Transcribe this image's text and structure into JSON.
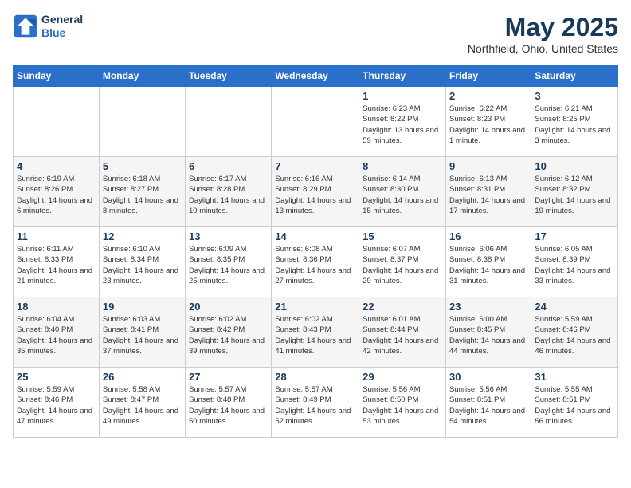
{
  "header": {
    "logo_line1": "General",
    "logo_line2": "Blue",
    "month": "May 2025",
    "location": "Northfield, Ohio, United States"
  },
  "days_of_week": [
    "Sunday",
    "Monday",
    "Tuesday",
    "Wednesday",
    "Thursday",
    "Friday",
    "Saturday"
  ],
  "weeks": [
    [
      {
        "day": "",
        "info": ""
      },
      {
        "day": "",
        "info": ""
      },
      {
        "day": "",
        "info": ""
      },
      {
        "day": "",
        "info": ""
      },
      {
        "day": "1",
        "info": "Sunrise: 6:23 AM\nSunset: 8:22 PM\nDaylight: 13 hours\nand 59 minutes."
      },
      {
        "day": "2",
        "info": "Sunrise: 6:22 AM\nSunset: 8:23 PM\nDaylight: 14 hours\nand 1 minute."
      },
      {
        "day": "3",
        "info": "Sunrise: 6:21 AM\nSunset: 8:25 PM\nDaylight: 14 hours\nand 3 minutes."
      }
    ],
    [
      {
        "day": "4",
        "info": "Sunrise: 6:19 AM\nSunset: 8:26 PM\nDaylight: 14 hours\nand 6 minutes."
      },
      {
        "day": "5",
        "info": "Sunrise: 6:18 AM\nSunset: 8:27 PM\nDaylight: 14 hours\nand 8 minutes."
      },
      {
        "day": "6",
        "info": "Sunrise: 6:17 AM\nSunset: 8:28 PM\nDaylight: 14 hours\nand 10 minutes."
      },
      {
        "day": "7",
        "info": "Sunrise: 6:16 AM\nSunset: 8:29 PM\nDaylight: 14 hours\nand 13 minutes."
      },
      {
        "day": "8",
        "info": "Sunrise: 6:14 AM\nSunset: 8:30 PM\nDaylight: 14 hours\nand 15 minutes."
      },
      {
        "day": "9",
        "info": "Sunrise: 6:13 AM\nSunset: 8:31 PM\nDaylight: 14 hours\nand 17 minutes."
      },
      {
        "day": "10",
        "info": "Sunrise: 6:12 AM\nSunset: 8:32 PM\nDaylight: 14 hours\nand 19 minutes."
      }
    ],
    [
      {
        "day": "11",
        "info": "Sunrise: 6:11 AM\nSunset: 8:33 PM\nDaylight: 14 hours\nand 21 minutes."
      },
      {
        "day": "12",
        "info": "Sunrise: 6:10 AM\nSunset: 8:34 PM\nDaylight: 14 hours\nand 23 minutes."
      },
      {
        "day": "13",
        "info": "Sunrise: 6:09 AM\nSunset: 8:35 PM\nDaylight: 14 hours\nand 25 minutes."
      },
      {
        "day": "14",
        "info": "Sunrise: 6:08 AM\nSunset: 8:36 PM\nDaylight: 14 hours\nand 27 minutes."
      },
      {
        "day": "15",
        "info": "Sunrise: 6:07 AM\nSunset: 8:37 PM\nDaylight: 14 hours\nand 29 minutes."
      },
      {
        "day": "16",
        "info": "Sunrise: 6:06 AM\nSunset: 8:38 PM\nDaylight: 14 hours\nand 31 minutes."
      },
      {
        "day": "17",
        "info": "Sunrise: 6:05 AM\nSunset: 8:39 PM\nDaylight: 14 hours\nand 33 minutes."
      }
    ],
    [
      {
        "day": "18",
        "info": "Sunrise: 6:04 AM\nSunset: 8:40 PM\nDaylight: 14 hours\nand 35 minutes."
      },
      {
        "day": "19",
        "info": "Sunrise: 6:03 AM\nSunset: 8:41 PM\nDaylight: 14 hours\nand 37 minutes."
      },
      {
        "day": "20",
        "info": "Sunrise: 6:02 AM\nSunset: 8:42 PM\nDaylight: 14 hours\nand 39 minutes."
      },
      {
        "day": "21",
        "info": "Sunrise: 6:02 AM\nSunset: 8:43 PM\nDaylight: 14 hours\nand 41 minutes."
      },
      {
        "day": "22",
        "info": "Sunrise: 6:01 AM\nSunset: 8:44 PM\nDaylight: 14 hours\nand 42 minutes."
      },
      {
        "day": "23",
        "info": "Sunrise: 6:00 AM\nSunset: 8:45 PM\nDaylight: 14 hours\nand 44 minutes."
      },
      {
        "day": "24",
        "info": "Sunrise: 5:59 AM\nSunset: 8:46 PM\nDaylight: 14 hours\nand 46 minutes."
      }
    ],
    [
      {
        "day": "25",
        "info": "Sunrise: 5:59 AM\nSunset: 8:46 PM\nDaylight: 14 hours\nand 47 minutes."
      },
      {
        "day": "26",
        "info": "Sunrise: 5:58 AM\nSunset: 8:47 PM\nDaylight: 14 hours\nand 49 minutes."
      },
      {
        "day": "27",
        "info": "Sunrise: 5:57 AM\nSunset: 8:48 PM\nDaylight: 14 hours\nand 50 minutes."
      },
      {
        "day": "28",
        "info": "Sunrise: 5:57 AM\nSunset: 8:49 PM\nDaylight: 14 hours\nand 52 minutes."
      },
      {
        "day": "29",
        "info": "Sunrise: 5:56 AM\nSunset: 8:50 PM\nDaylight: 14 hours\nand 53 minutes."
      },
      {
        "day": "30",
        "info": "Sunrise: 5:56 AM\nSunset: 8:51 PM\nDaylight: 14 hours\nand 54 minutes."
      },
      {
        "day": "31",
        "info": "Sunrise: 5:55 AM\nSunset: 8:51 PM\nDaylight: 14 hours\nand 56 minutes."
      }
    ]
  ]
}
